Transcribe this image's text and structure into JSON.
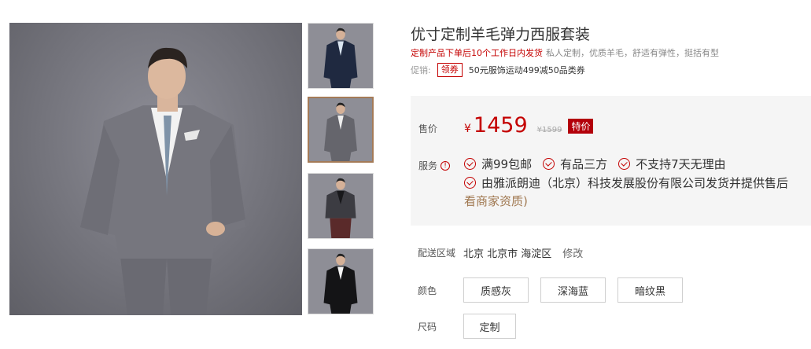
{
  "product": {
    "title": "优寸定制羊毛弹力西服套装",
    "subtitle_red": "定制产品下单后10个工作日内发货",
    "subtitle_grey": "私人定制，优质羊毛，舒适有弹性，挺括有型"
  },
  "promo": {
    "label": "促销:",
    "coupon": "领券",
    "text": "50元服饰运动499减50品类券"
  },
  "price": {
    "label": "售价",
    "currency": "¥",
    "value": "1459",
    "original": "¥1599",
    "badge": "特价"
  },
  "service": {
    "label": "服务",
    "info_glyph": "!",
    "items": [
      "满99包邮",
      "有品三方",
      "不支持7天无理由"
    ],
    "seller": "由雅派朗迪（北京）科技发展股份有限公司发货并提供售后",
    "link": "看商家资质)"
  },
  "shipping": {
    "label": "配送区域",
    "region": "北京 北京市 海淀区",
    "modify": "修改"
  },
  "color": {
    "label": "颜色",
    "options": [
      "质感灰",
      "深海蓝",
      "暗纹黑"
    ]
  },
  "size": {
    "label": "尺码",
    "options": [
      "定制"
    ]
  },
  "gallery": {
    "main_image": "grey-suit-model-photo",
    "thumbnails": [
      "navy-suit-thumb",
      "grey-suit-thumb",
      "black-turtleneck-suit-thumb",
      "black-suit-thumb"
    ]
  },
  "colors": {
    "accent_red": "#c40000",
    "badge_red": "#b3000a",
    "link_brown": "#a07850",
    "panel_bg": "#f5f5f5"
  }
}
